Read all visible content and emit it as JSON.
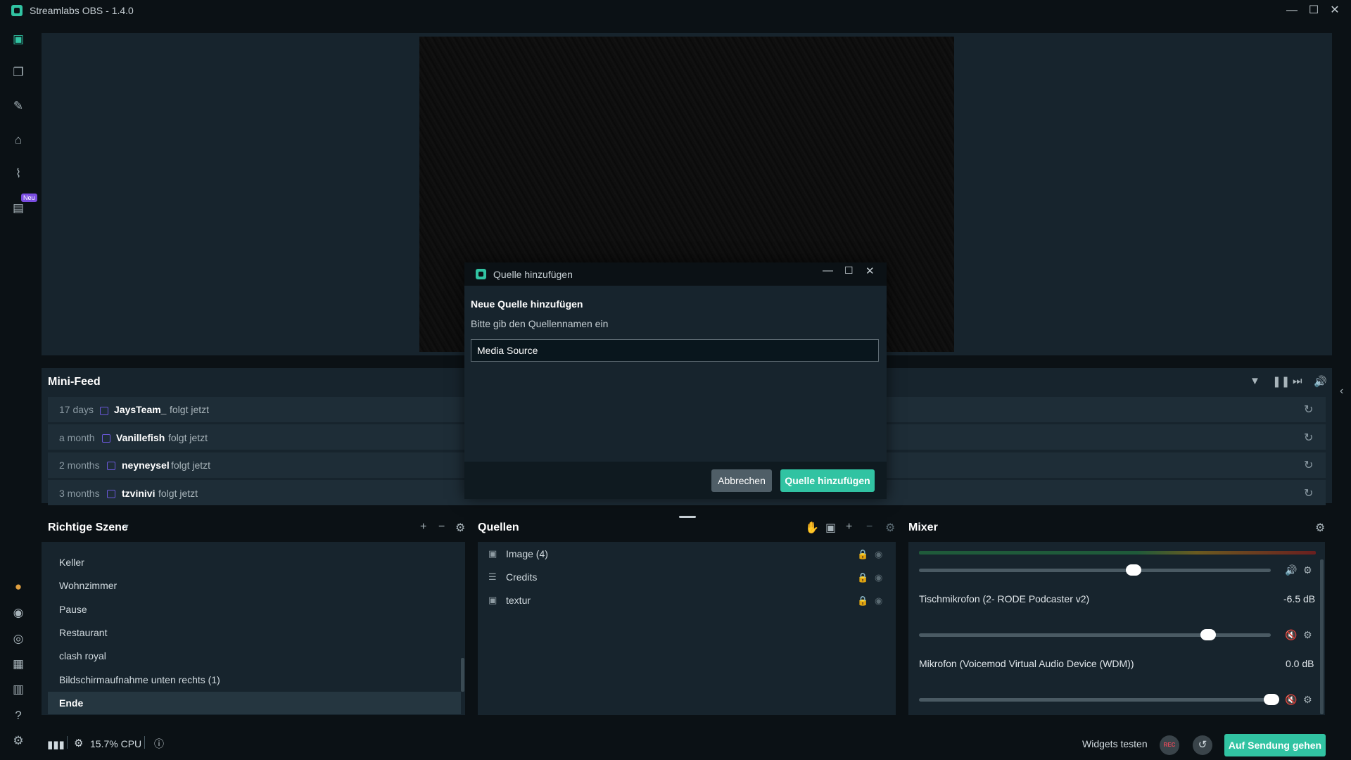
{
  "window": {
    "title": "Streamlabs OBS - 1.4.0",
    "minimize_glyph": "—",
    "maximize_glyph": "☐",
    "close_glyph": "✕"
  },
  "sidebar": {
    "new_badge": "Neu",
    "icons": [
      "studio-icon",
      "layout-editor-icon",
      "themes-icon",
      "app-store-icon",
      "analytics-icon",
      "highlighter-icon",
      "prime-icon",
      "chat-icon",
      "comments-icon",
      "dashboard-icon",
      "layers-icon",
      "help-icon",
      "settings-icon"
    ]
  },
  "minifeed": {
    "title": "Mini-Feed",
    "items": [
      {
        "time": "17 days",
        "name": "JaysTeam_",
        "action": "folgt jetzt"
      },
      {
        "time": "a month",
        "name": "Vanillefish",
        "action": "folgt jetzt"
      },
      {
        "time": "2 months",
        "name": "neyneysel",
        "action": "folgt jetzt"
      },
      {
        "time": "3 months",
        "name": "tzvinivi",
        "action": "folgt jetzt"
      }
    ]
  },
  "scenes": {
    "title": "Richtige Szene",
    "items": [
      "Keller",
      "Wohnzimmer",
      "Pause",
      "Restaurant",
      "clash royal",
      "Bildschirmaufnahme unten rechts (1)",
      "Ende"
    ],
    "selected": "Ende"
  },
  "sources": {
    "title": "Quellen",
    "items": [
      "Image (4)",
      "Credits",
      "textur"
    ]
  },
  "mixer": {
    "title": "Mixer",
    "channels": [
      {
        "name": "",
        "db": "",
        "level": 0.61
      },
      {
        "name": "Tischmikrofon (2- RODE Podcaster v2)",
        "db": "-6.5 dB",
        "level": 0.82
      },
      {
        "name": "Mikrofon (Voicemod Virtual Audio Device (WDM))",
        "db": "0.0 dB",
        "level": 1.0
      }
    ]
  },
  "status": {
    "cpu": "15.7% CPU",
    "widgets_test": "Widgets testen",
    "rec": "REC",
    "go_live": "Auf Sendung gehen"
  },
  "dialog": {
    "title": "Quelle hinzufügen",
    "heading": "Neue Quelle hinzufügen",
    "prompt": "Bitte gib den Quellennamen ein",
    "input_value": "Media Source",
    "cancel": "Abbrechen",
    "add": "Quelle hinzufügen"
  },
  "colors": {
    "accent": "#31c3a2",
    "panel": "#17242d",
    "background": "#0b1115"
  }
}
